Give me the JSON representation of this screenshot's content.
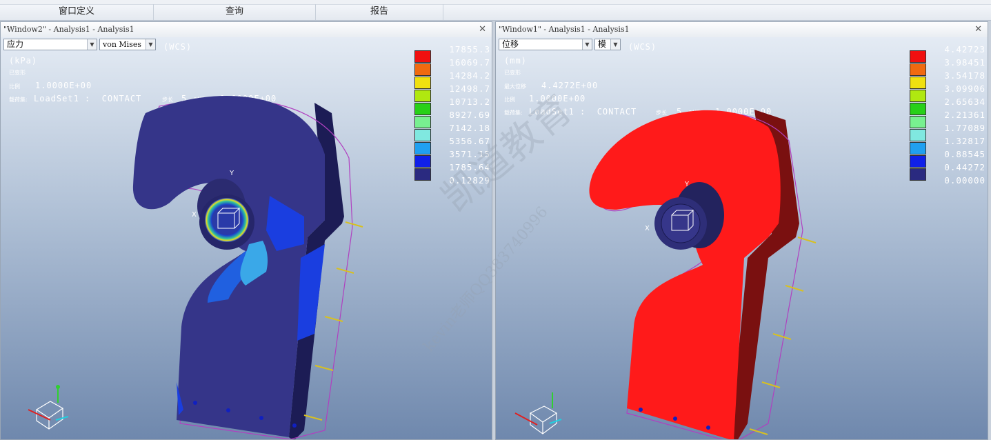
{
  "menu": {
    "items": [
      "窗口定义",
      "查询",
      "报告"
    ]
  },
  "left_window": {
    "title": "\"Window2\" - Analysis1 - Analysis1",
    "quantity_select": "应力",
    "component_select": "von Mises",
    "coord_label": "(WCS)",
    "units": "(kPa)",
    "deformed_label": "已变形",
    "scale_label": "比例",
    "scale_value": "1.0000E+00",
    "loadset_prefix": "载荷集:",
    "loadset_value": "LoadSet1 :  CONTACT",
    "step_label": "步长",
    "step_value": "5",
    "time_label": "时间",
    "time_value": "1.0000E+00",
    "legend_values": [
      "17855.3",
      "16069.7",
      "14284.2",
      "12498.7",
      "10713.2",
      "8927.69",
      "7142.18",
      "5356.67",
      "3571.15",
      "1785.64",
      "0.12829"
    ]
  },
  "right_window": {
    "title": "\"Window1\" - Analysis1 - Analysis1",
    "quantity_select": "位移",
    "component_select": "模",
    "coord_label": "(WCS)",
    "units": "(mm)",
    "deformed_label": "已变形",
    "max_disp_label": "最大位移",
    "max_disp_value": "4.4272E+00",
    "scale_label": "比例",
    "scale_value": "1.0000E+00",
    "loadset_prefix": "载荷集:",
    "loadset_value": "LoadSet1 :  CONTACT",
    "step_label": "步长",
    "step_value": "5",
    "time_label": "时间",
    "time_value": "1.0000E+00",
    "legend_values": [
      "4.42723",
      "3.98451",
      "3.54178",
      "3.09906",
      "2.65634",
      "2.21361",
      "1.77089",
      "1.32817",
      "0.88545",
      "0.44272",
      "0.00000"
    ]
  },
  "legend_colors": [
    "#f01010",
    "#f06a10",
    "#f0e010",
    "#b0e810",
    "#28d018",
    "#78f090",
    "#80e8e0",
    "#20a0f0",
    "#1020e8",
    "#2a2a80"
  ],
  "watermark": {
    "brand": "凯道教育",
    "contact": "kevin老师QQ383740996"
  },
  "triad_labels": {
    "x": "X",
    "y": "Y",
    "z": "Z"
  },
  "close_glyph": "✕"
}
